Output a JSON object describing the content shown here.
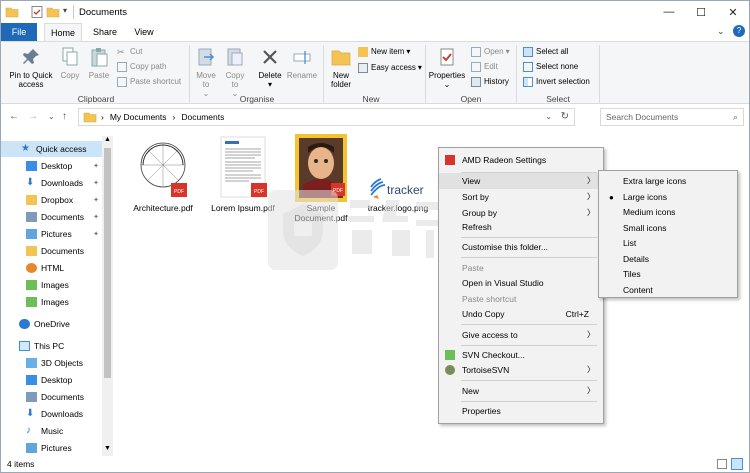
{
  "window": {
    "title": "Documents"
  },
  "ribbon_tabs": [
    "File",
    "Home",
    "Share",
    "View"
  ],
  "ribbon": {
    "clipboard": {
      "label": "Clipboard",
      "pin": "Pin to Quick access",
      "copy": "Copy",
      "paste": "Paste",
      "cut": "Cut",
      "copy_path": "Copy path",
      "paste_shortcut": "Paste shortcut"
    },
    "organise": {
      "label": "Organise",
      "move_to": "Move to",
      "copy_to": "Copy to",
      "delete": "Delete",
      "rename": "Rename"
    },
    "new": {
      "label": "New",
      "new_folder": "New folder",
      "new_item": "New item",
      "easy_access": "Easy access"
    },
    "open": {
      "label": "Open",
      "properties": "Properties",
      "open": "Open",
      "edit": "Edit",
      "history": "History"
    },
    "select": {
      "label": "Select",
      "select_all": "Select all",
      "select_none": "Select none",
      "invert": "Invert selection"
    }
  },
  "address": {
    "crumbs": [
      "My Documents",
      "Documents"
    ],
    "search_placeholder": "Search Documents"
  },
  "nav": {
    "items": [
      {
        "label": "Quick access"
      },
      {
        "label": "Desktop"
      },
      {
        "label": "Downloads"
      },
      {
        "label": "Dropbox"
      },
      {
        "label": "Documents"
      },
      {
        "label": "Pictures"
      },
      {
        "label": "Documents"
      },
      {
        "label": "HTML"
      },
      {
        "label": "Images"
      },
      {
        "label": "Images"
      },
      {
        "label": "OneDrive"
      },
      {
        "label": "This PC"
      },
      {
        "label": "3D Objects"
      },
      {
        "label": "Desktop"
      },
      {
        "label": "Documents"
      },
      {
        "label": "Downloads"
      },
      {
        "label": "Music"
      },
      {
        "label": "Pictures"
      }
    ]
  },
  "files": [
    {
      "name": "Architecture.pdf"
    },
    {
      "name": "Lorem Ipsum.pdf"
    },
    {
      "name": "Sample Document.pdf"
    },
    {
      "name": "tracker.logo.png",
      "logo_text": "tracker"
    }
  ],
  "status": {
    "count": "4 items"
  },
  "context_menu": {
    "items": [
      {
        "label": "AMD Radeon Settings"
      },
      {
        "label": "View"
      },
      {
        "label": "Sort by"
      },
      {
        "label": "Group by"
      },
      {
        "label": "Refresh"
      },
      {
        "label": "Customise this folder..."
      },
      {
        "label": "Paste"
      },
      {
        "label": "Open in Visual Studio"
      },
      {
        "label": "Paste shortcut"
      },
      {
        "label": "Undo Copy",
        "shortcut": "Ctrl+Z"
      },
      {
        "label": "Give access to"
      },
      {
        "label": "SVN Checkout..."
      },
      {
        "label": "TortoiseSVN"
      },
      {
        "label": "New"
      },
      {
        "label": "Properties"
      }
    ]
  },
  "view_submenu": {
    "items": [
      {
        "label": "Extra large icons"
      },
      {
        "label": "Large icons"
      },
      {
        "label": "Medium icons"
      },
      {
        "label": "Small icons"
      },
      {
        "label": "List"
      },
      {
        "label": "Details"
      },
      {
        "label": "Tiles"
      },
      {
        "label": "Content"
      }
    ],
    "selected": "Large icons"
  },
  "colors": {
    "accent": "#1e6ab8",
    "folder": "#f3c453",
    "pdf_red": "#d8352a",
    "selection": "#cce4f7"
  }
}
